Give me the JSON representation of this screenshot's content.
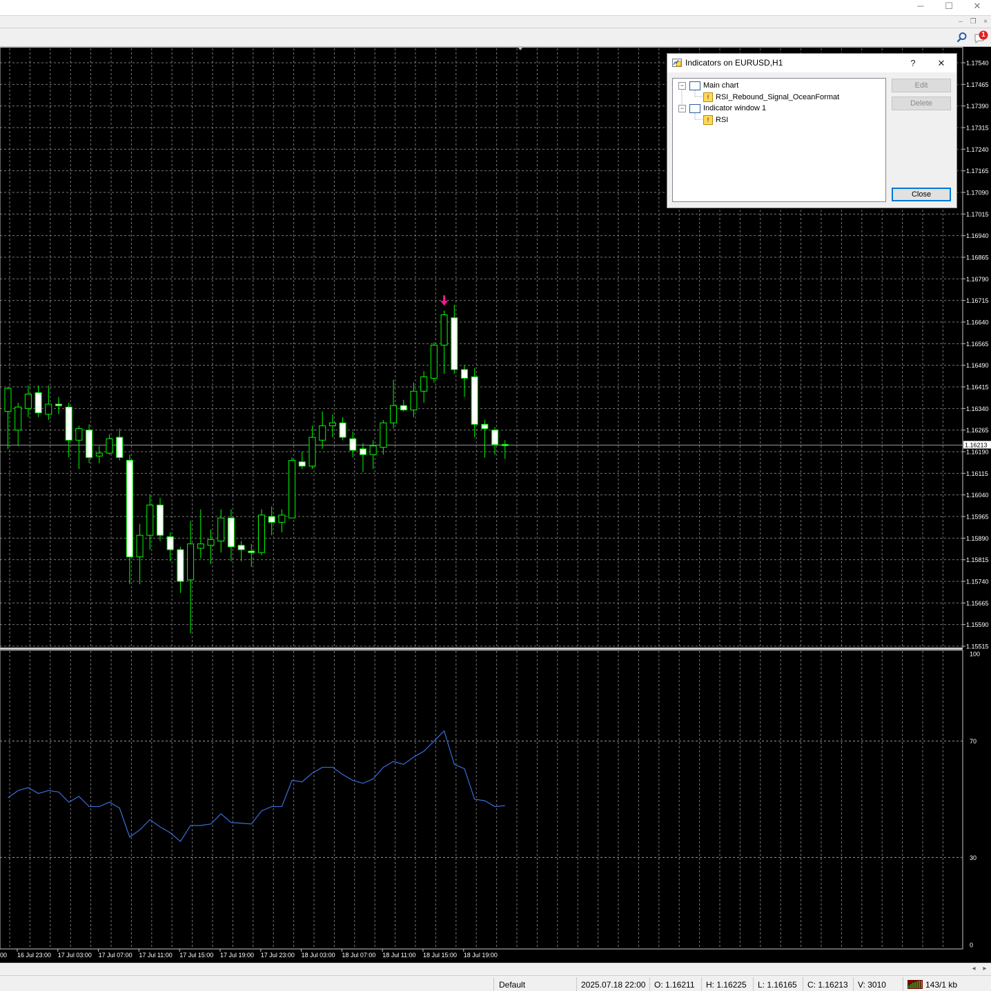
{
  "window": {
    "minimize_glyph": "─",
    "maximize_glyph": "☐",
    "close_glyph": "✕",
    "mdi_minimize_glyph": "–",
    "mdi_restore_glyph": "❐",
    "mdi_close_glyph": "×"
  },
  "toolbar": {
    "search_icon": "search-icon",
    "notification_count": "1"
  },
  "chart_data": [
    {
      "type": "candlestick",
      "symbol": "EURUSD",
      "timeframe": "H1",
      "y_axis_labels": [
        "1.17540",
        "1.17465",
        "1.17390",
        "1.17315",
        "1.17240",
        "1.17165",
        "1.17090",
        "1.17015",
        "1.16940",
        "1.16865",
        "1.16790",
        "1.16715",
        "1.16640",
        "1.16565",
        "1.16490",
        "1.16415",
        "1.16340",
        "1.16265",
        "1.16190",
        "1.16115",
        "1.16040",
        "1.15965",
        "1.15890",
        "1.15815",
        "1.15740",
        "1.15665",
        "1.15590",
        "1.15515"
      ],
      "ylim": [
        1.15515,
        1.1754
      ],
      "current_price": "1.16213",
      "x_axis_labels": [
        "16 Jul 23:00",
        "17 Jul 03:00",
        "17 Jul 07:00",
        "17 Jul 11:00",
        "17 Jul 15:00",
        "17 Jul 19:00",
        "17 Jul 23:00",
        "18 Jul 03:00",
        "18 Jul 07:00",
        "18 Jul 11:00",
        "18 Jul 15:00",
        "18 Jul 19:00"
      ],
      "x_axis_partial_label": "00",
      "grid": true,
      "bull_color": "#00ff00",
      "bear_color": "#ffffff",
      "signal_arrow_color": "#ff1493",
      "signal_arrow_bar_index": 43,
      "candles": [
        {
          "o": 1.1633,
          "h": 1.16415,
          "l": 1.162,
          "c": 1.1641
        },
        {
          "o": 1.16265,
          "h": 1.1636,
          "l": 1.1621,
          "c": 1.16345
        },
        {
          "o": 1.1634,
          "h": 1.1642,
          "l": 1.1631,
          "c": 1.1639
        },
        {
          "o": 1.16395,
          "h": 1.1642,
          "l": 1.1631,
          "c": 1.16325
        },
        {
          "o": 1.1632,
          "h": 1.1642,
          "l": 1.163,
          "c": 1.16355
        },
        {
          "o": 1.16355,
          "h": 1.1638,
          "l": 1.1632,
          "c": 1.1635
        },
        {
          "o": 1.16345,
          "h": 1.1636,
          "l": 1.1617,
          "c": 1.1623
        },
        {
          "o": 1.1623,
          "h": 1.1628,
          "l": 1.1613,
          "c": 1.1627
        },
        {
          "o": 1.16265,
          "h": 1.16285,
          "l": 1.1615,
          "c": 1.1617
        },
        {
          "o": 1.16175,
          "h": 1.1621,
          "l": 1.1615,
          "c": 1.16185
        },
        {
          "o": 1.16185,
          "h": 1.1625,
          "l": 1.1618,
          "c": 1.16235
        },
        {
          "o": 1.1624,
          "h": 1.1627,
          "l": 1.1616,
          "c": 1.1617
        },
        {
          "o": 1.1616,
          "h": 1.1618,
          "l": 1.1573,
          "c": 1.15825
        },
        {
          "o": 1.15825,
          "h": 1.1594,
          "l": 1.1573,
          "c": 1.159
        },
        {
          "o": 1.159,
          "h": 1.1604,
          "l": 1.1585,
          "c": 1.16005
        },
        {
          "o": 1.16005,
          "h": 1.1603,
          "l": 1.1588,
          "c": 1.159
        },
        {
          "o": 1.15895,
          "h": 1.1591,
          "l": 1.1581,
          "c": 1.1585
        },
        {
          "o": 1.1585,
          "h": 1.1586,
          "l": 1.157,
          "c": 1.1574
        },
        {
          "o": 1.15745,
          "h": 1.1595,
          "l": 1.1556,
          "c": 1.1587
        },
        {
          "o": 1.15855,
          "h": 1.1599,
          "l": 1.1582,
          "c": 1.1587
        },
        {
          "o": 1.15865,
          "h": 1.1592,
          "l": 1.158,
          "c": 1.15885
        },
        {
          "o": 1.1588,
          "h": 1.1599,
          "l": 1.1584,
          "c": 1.1596
        },
        {
          "o": 1.1596,
          "h": 1.1599,
          "l": 1.1581,
          "c": 1.1586
        },
        {
          "o": 1.15865,
          "h": 1.1588,
          "l": 1.1581,
          "c": 1.1585
        },
        {
          "o": 1.15845,
          "h": 1.1587,
          "l": 1.1579,
          "c": 1.1584
        },
        {
          "o": 1.1584,
          "h": 1.1599,
          "l": 1.1583,
          "c": 1.1597
        },
        {
          "o": 1.15965,
          "h": 1.16,
          "l": 1.159,
          "c": 1.15945
        },
        {
          "o": 1.15945,
          "h": 1.1599,
          "l": 1.1591,
          "c": 1.1597
        },
        {
          "o": 1.1596,
          "h": 1.1617,
          "l": 1.1596,
          "c": 1.1616
        },
        {
          "o": 1.16155,
          "h": 1.1619,
          "l": 1.1613,
          "c": 1.1614
        },
        {
          "o": 1.1614,
          "h": 1.1628,
          "l": 1.1613,
          "c": 1.1624
        },
        {
          "o": 1.1623,
          "h": 1.1633,
          "l": 1.162,
          "c": 1.1628
        },
        {
          "o": 1.1628,
          "h": 1.1632,
          "l": 1.1624,
          "c": 1.1629
        },
        {
          "o": 1.1629,
          "h": 1.1631,
          "l": 1.1623,
          "c": 1.1624
        },
        {
          "o": 1.16235,
          "h": 1.1626,
          "l": 1.1617,
          "c": 1.16195
        },
        {
          "o": 1.162,
          "h": 1.1622,
          "l": 1.1612,
          "c": 1.1618
        },
        {
          "o": 1.1618,
          "h": 1.1623,
          "l": 1.1613,
          "c": 1.1621
        },
        {
          "o": 1.16205,
          "h": 1.163,
          "l": 1.1618,
          "c": 1.1629
        },
        {
          "o": 1.1629,
          "h": 1.1644,
          "l": 1.1627,
          "c": 1.1635
        },
        {
          "o": 1.1635,
          "h": 1.1637,
          "l": 1.1633,
          "c": 1.16335
        },
        {
          "o": 1.16335,
          "h": 1.1643,
          "l": 1.1631,
          "c": 1.164
        },
        {
          "o": 1.164,
          "h": 1.1647,
          "l": 1.1636,
          "c": 1.1645
        },
        {
          "o": 1.16445,
          "h": 1.1657,
          "l": 1.1643,
          "c": 1.1656
        },
        {
          "o": 1.1656,
          "h": 1.1668,
          "l": 1.1646,
          "c": 1.16665
        },
        {
          "o": 1.16655,
          "h": 1.167,
          "l": 1.1646,
          "c": 1.16475
        },
        {
          "o": 1.16475,
          "h": 1.1649,
          "l": 1.1638,
          "c": 1.16445
        },
        {
          "o": 1.1645,
          "h": 1.1648,
          "l": 1.1624,
          "c": 1.16285
        },
        {
          "o": 1.16285,
          "h": 1.163,
          "l": 1.1617,
          "c": 1.1627
        },
        {
          "o": 1.16265,
          "h": 1.16275,
          "l": 1.1618,
          "c": 1.16215
        },
        {
          "o": 1.16215,
          "h": 1.1623,
          "l": 1.16165,
          "c": 1.16213
        }
      ]
    },
    {
      "type": "line",
      "name": "RSI",
      "y_axis_labels": [
        "100",
        "70",
        "30",
        "0"
      ],
      "levels": [
        70,
        30
      ],
      "ylim": [
        0,
        100
      ],
      "grid": true,
      "line_color": "#3a6fd8",
      "values": [
        50.5,
        53,
        54,
        52,
        53,
        52.5,
        49,
        51,
        47.5,
        47.5,
        49,
        47,
        37,
        39.5,
        43,
        40.5,
        38.5,
        35.5,
        41,
        41,
        41.5,
        45,
        42,
        41.8,
        41.5,
        46,
        47.5,
        47.5,
        56.5,
        56,
        59,
        61,
        61,
        58.5,
        56.5,
        55.5,
        57,
        61,
        63,
        62,
        64.5,
        66.5,
        70,
        73.5,
        62,
        60.5,
        50,
        49.5,
        47.5,
        47.8
      ]
    }
  ],
  "dialog": {
    "title": "Indicators on EURUSD,H1",
    "help_label": "?",
    "close_glyph": "✕",
    "tree": [
      {
        "label": "Main chart",
        "expander": "−",
        "children": [
          {
            "label": "RSI_Rebound_Signal_OceanFormat"
          }
        ]
      },
      {
        "label": "Indicator window 1",
        "expander": "−",
        "children": [
          {
            "label": "RSI"
          }
        ]
      }
    ],
    "ind_icon_glyph": "f",
    "buttons": {
      "edit": "Edit",
      "delete": "Delete",
      "close": "Close"
    }
  },
  "scroll": {
    "left_glyph": "◂",
    "right_glyph": "▸"
  },
  "status": {
    "profile": "Default",
    "datetime": "2025.07.18 22:00",
    "open": "O: 1.16211",
    "high": "H: 1.16225",
    "low": "L: 1.16165",
    "close": "C: 1.16213",
    "volume": "V: 3010",
    "traffic": "143/1 kb"
  }
}
